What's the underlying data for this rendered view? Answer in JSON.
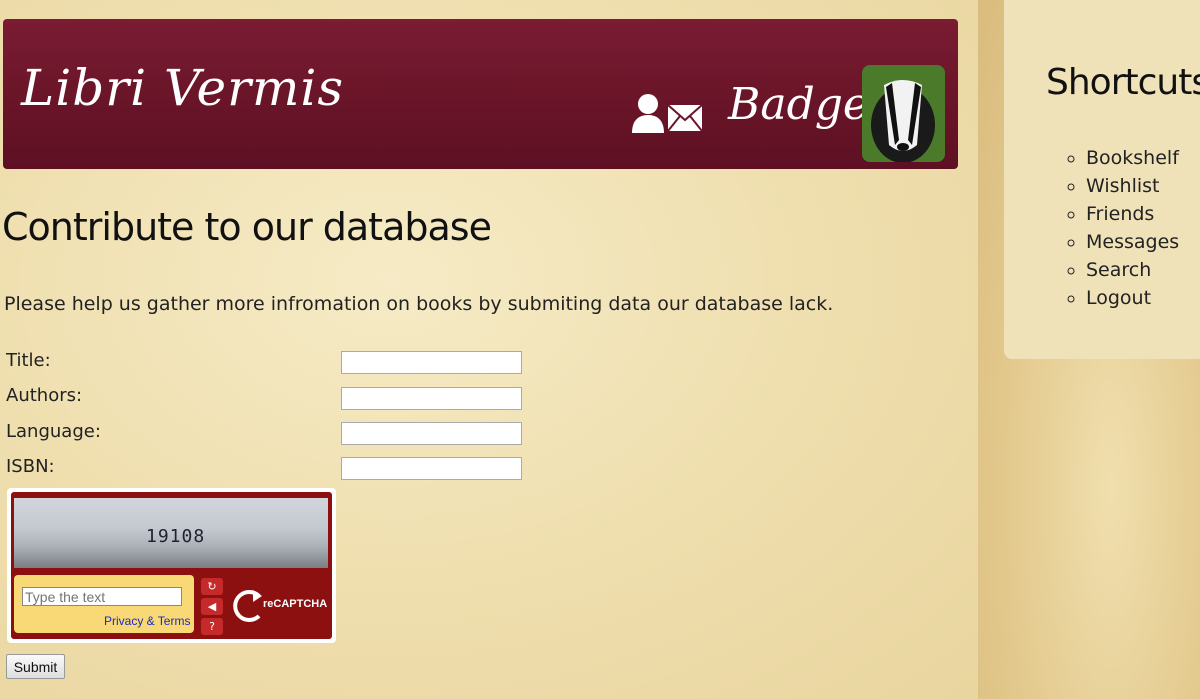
{
  "header": {
    "logo": "Libri Vermis",
    "username": "Badger"
  },
  "main": {
    "title": "Contribute to our database",
    "intro": "Please help us gather more infromation on books by submiting data our database lack.",
    "fields": [
      {
        "label": "Title:"
      },
      {
        "label": "Authors:"
      },
      {
        "label": "Language:"
      },
      {
        "label": "ISBN:"
      }
    ],
    "captcha": {
      "word": "19108",
      "placeholder": "Type the text",
      "links": "Privacy & Terms",
      "brand": "reCAPTCHA"
    },
    "submit_label": "Submit"
  },
  "sidebar": {
    "title": "Shortcuts:",
    "items": [
      "Bookshelf",
      "Wishlist",
      "Friends",
      "Messages",
      "Search",
      "Logout"
    ]
  },
  "colors": {
    "header_bg": "#6b1529",
    "captcha_red": "#8c1010",
    "captcha_yellow": "#f9d976"
  }
}
